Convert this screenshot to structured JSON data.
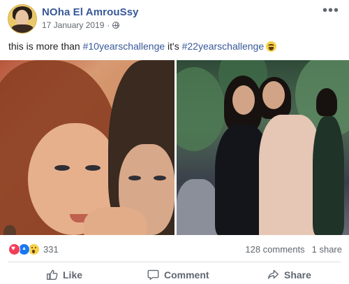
{
  "post": {
    "author": "NOha El AmrouSsy",
    "date": "17 January 2019",
    "separator": "·",
    "text_before": "this is more than ",
    "hashtag1": "#10yearschallenge",
    "text_middle": " it's ",
    "hashtag2": "#22yearschallenge",
    "reaction_count": "331",
    "comments": "128 comments",
    "shares": "1 share"
  },
  "actions": {
    "like": "Like",
    "comment": "Comment",
    "share": "Share"
  },
  "icons": {
    "more": "more-options-icon",
    "privacy": "globe-icon",
    "emoji": "laughing-emoji-icon",
    "reactions": [
      "love-icon",
      "like-icon",
      "wow-icon"
    ]
  },
  "colors": {
    "link": "#385898",
    "meta": "#616770",
    "love": "#f33e58",
    "like": "#1877f2",
    "wow": "#f7d047"
  }
}
